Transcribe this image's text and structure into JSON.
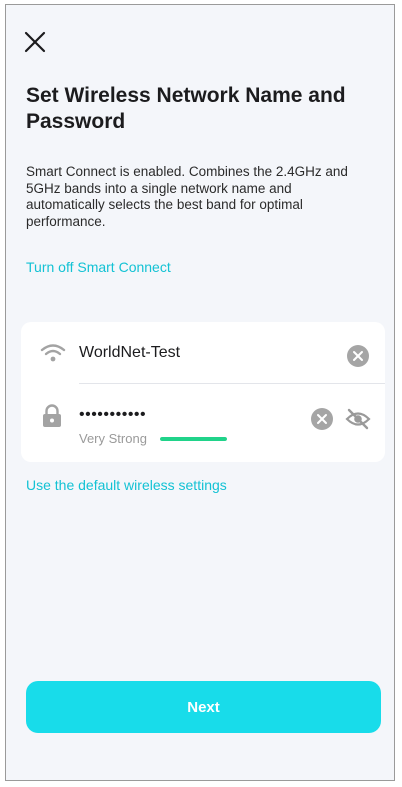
{
  "header": {
    "close_icon": "close-icon",
    "title": "Set Wireless Network Name and Password",
    "description": "Smart Connect is enabled. Combines the 2.4GHz and 5GHz bands into a single network name and automatically selects the best band for optimal performance."
  },
  "smart_connect_link": "Turn off Smart Connect",
  "network_name": {
    "icon": "wifi-icon",
    "value": "WorldNet-Test",
    "clear_icon": "clear-icon"
  },
  "password": {
    "icon": "lock-icon",
    "value": "•••••••••••",
    "clear_icon": "clear-icon",
    "visibility_icon": "eye-off-icon",
    "strength_label": "Very Strong",
    "strength_level": 1.0
  },
  "default_settings_link": "Use the default wireless settings",
  "next_button": "Next",
  "colors": {
    "accent": "#18dcea",
    "link": "#13c2d4",
    "strength": "#20d38a",
    "background": "#f4f6fa"
  }
}
